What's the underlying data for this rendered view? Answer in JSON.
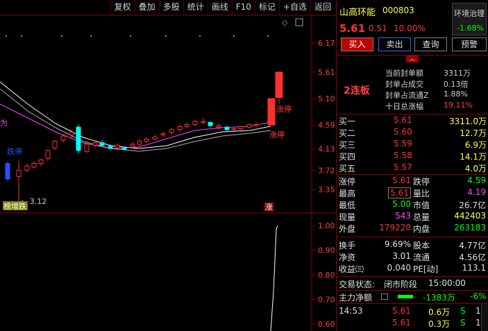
{
  "toolbar": [
    "复权",
    "叠加",
    "多股",
    "统计",
    "画线",
    "F10",
    "标记",
    "+自选",
    "返回"
  ],
  "chart": {
    "price_axis": [
      "6.17",
      "5.61",
      "5.10",
      "4.59",
      "4.13",
      "3.72",
      "3.35"
    ],
    "sub_axis": [
      "1.00",
      "0.90",
      "0.80",
      "0.70",
      "0.60"
    ],
    "labels": {
      "low_price": "3.12",
      "limit_up_1": "涨停",
      "limit_up_2": "涨停",
      "limit_down": "跌停",
      "marker_left": "榜增跌",
      "marker_right": "涨",
      "pink_left": "为"
    },
    "colors": {
      "up": "#ff3030",
      "down": "#00ffff",
      "down_fill": "#2a4fff",
      "ma1": "#ffffff",
      "ma2": "#ff40ff",
      "ma3": "#b0b0b0"
    }
  },
  "quote": {
    "name": "山高环能",
    "code": "000803",
    "industry": "环境治理",
    "industry_pct": "-1.68%",
    "price": "5.61",
    "change": "0.51",
    "change_pct": "10.00%"
  },
  "buttons": {
    "buy": "买入",
    "sell": "卖出",
    "query": "查询",
    "alert": "预警"
  },
  "seal": {
    "lianban": "2连板",
    "rows": [
      {
        "k": "当前封单额",
        "v": "3311万",
        "red": false
      },
      {
        "k": "封单占成交",
        "v": "0.13倍",
        "red": false
      },
      {
        "k": "封单占流通Z",
        "v": "1.88%",
        "red": false
      },
      {
        "k": "十日总涨幅",
        "v": "19.11%",
        "red": true
      }
    ]
  },
  "bids": [
    {
      "label": "买一",
      "price": "5.61",
      "vol": "3311.0万"
    },
    {
      "label": "买二",
      "price": "5.60",
      "vol": "12.7万"
    },
    {
      "label": "买三",
      "price": "5.59",
      "vol": "6.9万"
    },
    {
      "label": "买四",
      "price": "5.58",
      "vol": "14.1万"
    },
    {
      "label": "买五",
      "price": "5.57",
      "vol": "4.0万"
    }
  ],
  "stats": {
    "zt_label": "涨停",
    "zt": "5.61",
    "dt_label": "跌停",
    "dt": "4.59",
    "high_label": "最高",
    "high": "5.61",
    "lb_label": "量比",
    "lb": "4.19",
    "low_label": "最低",
    "low": "5.00",
    "mv_label": "市值",
    "mv": "26.7亿",
    "xl_label": "现量",
    "xl": "543",
    "zl_label": "总量",
    "zl": "442403",
    "wp_label": "外盘",
    "wp": "179220",
    "np_label": "内盘",
    "np": "263183",
    "hs_label": "换手",
    "hs": "9.69%",
    "gb_label": "股本",
    "gb": "4.77亿",
    "jz_label": "净资",
    "jz": "3.01",
    "lt_label": "流通",
    "lt": "4.56亿",
    "sy_label": "收益㈢",
    "sy": "0.040",
    "pe_label": "PE[动]",
    "pe": "113.1"
  },
  "status": {
    "label": "交易状态:",
    "value": "闭市阶段",
    "time": "15:00:00"
  },
  "net": {
    "label": "主力净额",
    "value": "-1383万",
    "pct": "-6%"
  },
  "ticks": [
    {
      "time": "14:53",
      "price": "5.61",
      "vol": "0.6万",
      "dir": "S",
      "n": "1"
    },
    {
      "time": "",
      "price": "5.61",
      "vol": "0.3万",
      "dir": "S",
      "n": "1"
    }
  ]
}
